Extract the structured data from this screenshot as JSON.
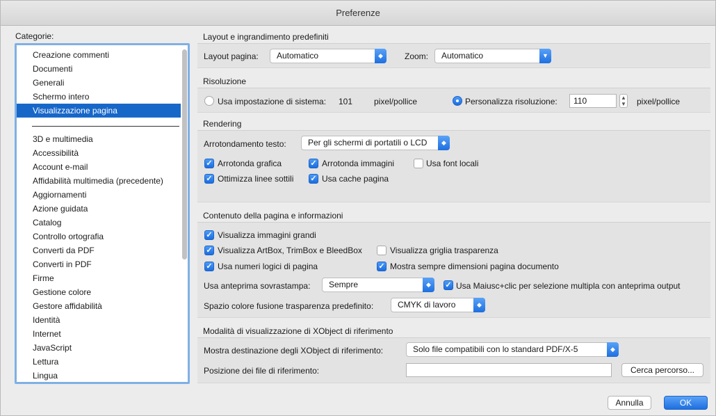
{
  "window": {
    "title": "Preferenze"
  },
  "categories": {
    "label": "Categorie:",
    "top_items": [
      "Creazione commenti",
      "Documenti",
      "Generali",
      "Schermo intero",
      "Visualizzazione pagina"
    ],
    "selected_index": 4,
    "items": [
      "3D e multimedia",
      "Accessibilità",
      "Account e-mail",
      "Affidabilità multimedia (precedente)",
      "Aggiornamenti",
      "Azione guidata",
      "Catalog",
      "Controllo ortografia",
      "Converti da PDF",
      "Converti in PDF",
      "Firme",
      "Gestione colore",
      "Gestore affidabilità",
      "Identità",
      "Internet",
      "JavaScript",
      "Lettura",
      "Lingua"
    ]
  },
  "layout": {
    "title": "Layout e ingrandimento predefiniti",
    "page_layout_label": "Layout pagina:",
    "page_layout_value": "Automatico",
    "zoom_label": "Zoom:",
    "zoom_value": "Automatico"
  },
  "resolution": {
    "title": "Risoluzione",
    "system_label": "Usa impostazione di sistema:",
    "system_value": "101",
    "system_unit": "pixel/pollice",
    "custom_label": "Personalizza risoluzione:",
    "custom_value": "110",
    "custom_unit": "pixel/pollice"
  },
  "rendering": {
    "title": "Rendering",
    "text_smoothing_label": "Arrotondamento testo:",
    "text_smoothing_value": "Per gli schermi di portatili o LCD",
    "smooth_art": "Arrotonda grafica",
    "smooth_images": "Arrotonda immagini",
    "local_fonts": "Usa font locali",
    "thin_lines": "Ottimizza linee sottili",
    "page_cache": "Usa cache pagina"
  },
  "page_content": {
    "title": "Contenuto della pagina e informazioni",
    "large_images": "Visualizza immagini grandi",
    "artbox": "Visualizza ArtBox, TrimBox e BleedBox",
    "transparency_grid": "Visualizza griglia trasparenza",
    "logical_numbers": "Usa numeri logici di pagina",
    "doc_page_size": "Mostra sempre dimensioni pagina documento",
    "overprint_label": "Usa anteprima sovrastampa:",
    "overprint_value": "Sempre",
    "shift_click": "Usa Maiusc+clic per selezione multipla con anteprima output",
    "blend_space_label": "Spazio colore fusione trasparenza predefinito:",
    "blend_space_value": "CMYK di lavoro"
  },
  "xobject": {
    "title": "Modalità di visualizzazione di XObject di riferimento",
    "target_label": "Mostra destinazione degli XObject di riferimento:",
    "target_value": "Solo file compatibili con lo standard PDF/X-5",
    "location_label": "Posizione dei file di riferimento:",
    "location_value": "",
    "browse_button": "Cerca percorso..."
  },
  "footer": {
    "cancel": "Annulla",
    "ok": "OK"
  },
  "colors": {
    "accent": "#1767c9",
    "focus_ring": "#7fb0e4"
  }
}
